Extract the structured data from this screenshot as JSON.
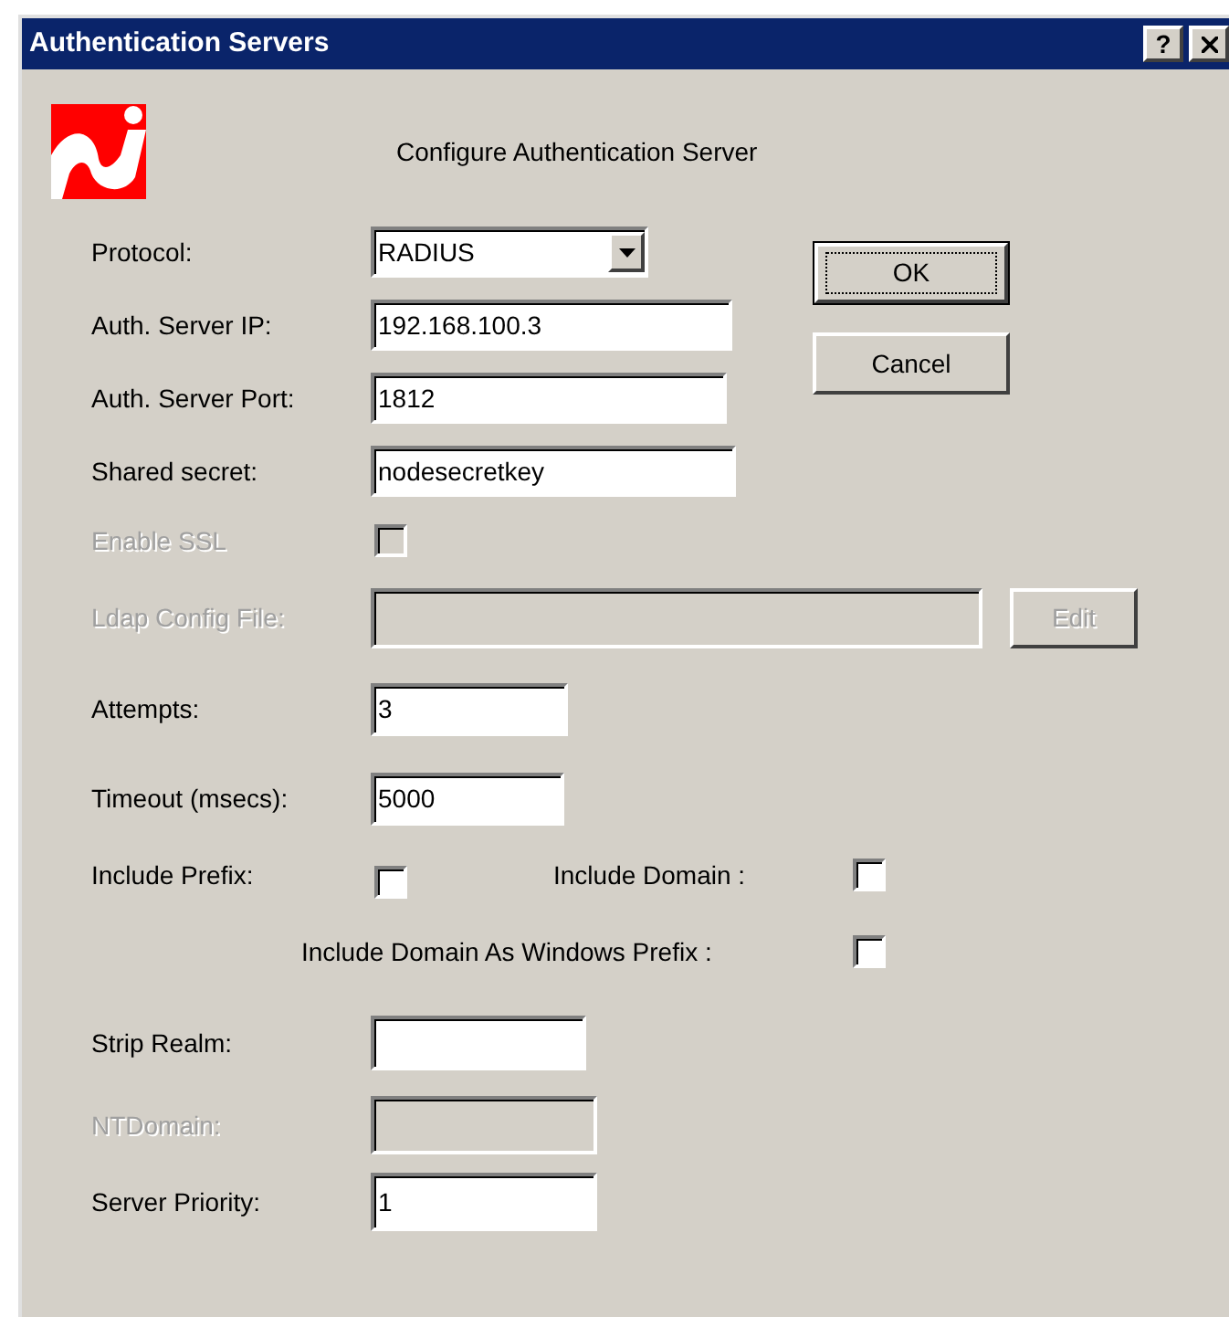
{
  "window": {
    "title": "Authentication Servers",
    "help": "?"
  },
  "header": {
    "heading": "Configure Authentication Server"
  },
  "rows": [
    {
      "kind": "select",
      "label": "Protocol:",
      "value": "RADIUS",
      "disabled": false
    },
    {
      "kind": "text",
      "label": "Auth. Server IP:",
      "value": "192.168.100.3",
      "disabled": false
    },
    {
      "kind": "text",
      "label": "Auth. Server Port:",
      "value": "1812",
      "disabled": false
    },
    {
      "kind": "text",
      "label": "Shared secret:",
      "value": "nodesecretkey",
      "disabled": false
    },
    {
      "kind": "checkbox",
      "label": "Enable SSL",
      "checked": false,
      "disabled": true
    },
    {
      "kind": "file",
      "label": "Ldap Config File:",
      "button": "Edit",
      "disabled": true
    },
    {
      "kind": "text",
      "label": "Attempts:",
      "value": "3",
      "disabled": false
    },
    {
      "kind": "text",
      "label": "Timeout (msecs):",
      "value": "5000",
      "disabled": false
    },
    {
      "kind": "checkbox_pair",
      "label": "Include Prefix:",
      "checked": false,
      "disabled": false,
      "second": {
        "label": "Include Domain :",
        "checked": false
      }
    },
    {
      "kind": "checkbox_right",
      "label": "Include Domain As Windows Prefix :",
      "checked": false,
      "disabled": false
    },
    {
      "kind": "text",
      "label": "Strip Realm:",
      "disabled": false
    },
    {
      "kind": "text",
      "label": "NTDomain:",
      "disabled": true
    },
    {
      "kind": "text",
      "label": "Server Priority:",
      "value": "1",
      "disabled": false
    }
  ],
  "buttons": [
    {
      "label": "OK",
      "default": true
    },
    {
      "label": "Cancel",
      "default": false
    }
  ]
}
